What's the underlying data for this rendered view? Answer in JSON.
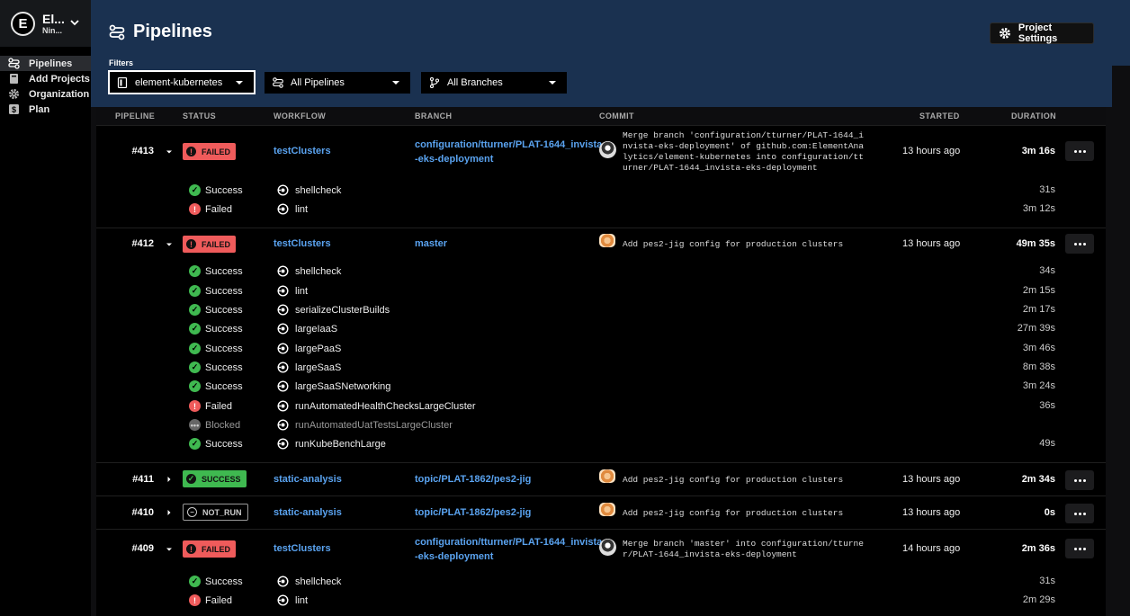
{
  "sidebar": {
    "org_initial": "E",
    "org_name": "El...",
    "org_sub": "Nin...",
    "items": [
      {
        "label": "Pipelines",
        "icon": "pipelines-icon"
      },
      {
        "label": "Add Projects",
        "icon": "book-icon"
      },
      {
        "label": "Organization Settings",
        "icon": "gear-icon"
      },
      {
        "label": "Plan",
        "icon": "dollar-icon"
      }
    ]
  },
  "header": {
    "title": "Pipelines",
    "project_settings": "Project Settings",
    "filters_label": "Filters",
    "filters": {
      "project": "element-kubernetes",
      "pipelines": "All Pipelines",
      "branches": "All Branches"
    }
  },
  "table": {
    "columns": [
      "PIPELINE",
      "STATUS",
      "WORKFLOW",
      "BRANCH",
      "COMMIT",
      "STARTED",
      "DURATION"
    ],
    "pipelines": [
      {
        "id": "#413",
        "status": "FAILED",
        "workflow": "testClusters",
        "branch_line1": "configuration/tturner/PLAT-1644_invista",
        "branch_line2": "-eks-deployment",
        "commit": "Merge branch 'configuration/tturner/PLAT-1644_i\nnvista-eks-deployment' of github.com:ElementAna\nlytics/element-kubernetes into configuration/tt\nurner/PLAT-1644_invista-eks-deployment",
        "started": "13 hours ago",
        "duration": "3m 16s",
        "jobs": [
          {
            "status": "Success",
            "name": "shellcheck",
            "duration": "31s"
          },
          {
            "status": "Failed",
            "name": "lint",
            "duration": "3m 12s"
          }
        ]
      },
      {
        "id": "#412",
        "status": "FAILED",
        "workflow": "testClusters",
        "branch_line1": "master",
        "branch_line2": "",
        "commit": "Add pes2-jig config for production clusters",
        "started": "13 hours ago",
        "duration": "49m 35s",
        "jobs": [
          {
            "status": "Success",
            "name": "shellcheck",
            "duration": "34s"
          },
          {
            "status": "Success",
            "name": "lint",
            "duration": "2m 15s"
          },
          {
            "status": "Success",
            "name": "serializeClusterBuilds",
            "duration": "2m 17s"
          },
          {
            "status": "Success",
            "name": "largeIaaS",
            "duration": "27m 39s"
          },
          {
            "status": "Success",
            "name": "largePaaS",
            "duration": "3m 46s"
          },
          {
            "status": "Success",
            "name": "largeSaaS",
            "duration": "8m 38s"
          },
          {
            "status": "Success",
            "name": "largeSaaSNetworking",
            "duration": "3m 24s"
          },
          {
            "status": "Failed",
            "name": "runAutomatedHealthChecksLargeCluster",
            "duration": "36s"
          },
          {
            "status": "Blocked",
            "name": "runAutomatedUatTestsLargeCluster",
            "duration": ""
          },
          {
            "status": "Success",
            "name": "runKubeBenchLarge",
            "duration": "49s"
          }
        ]
      },
      {
        "id": "#411",
        "status": "SUCCESS",
        "workflow": "static-analysis",
        "branch_line1": "topic/PLAT-1862/pes2-jig",
        "branch_line2": "",
        "commit": "Add pes2-jig config for production clusters",
        "started": "13 hours ago",
        "duration": "2m 34s",
        "jobs": []
      },
      {
        "id": "#410",
        "status": "NOT_RUN",
        "workflow": "static-analysis",
        "branch_line1": "topic/PLAT-1862/pes2-jig",
        "branch_line2": "",
        "commit": "Add pes2-jig config for production clusters",
        "started": "13 hours ago",
        "duration": "0s",
        "jobs": []
      },
      {
        "id": "#409",
        "status": "FAILED",
        "workflow": "testClusters",
        "branch_line1": "configuration/tturner/PLAT-1644_invista",
        "branch_line2": "-eks-deployment",
        "commit": "Merge branch 'master' into configuration/tturne\nr/PLAT-1644_invista-eks-deployment",
        "started": "14 hours ago",
        "duration": "2m 36s",
        "jobs": [
          {
            "status": "Success",
            "name": "shellcheck",
            "duration": "31s"
          },
          {
            "status": "Failed",
            "name": "lint",
            "duration": "2m 29s"
          }
        ]
      }
    ]
  }
}
